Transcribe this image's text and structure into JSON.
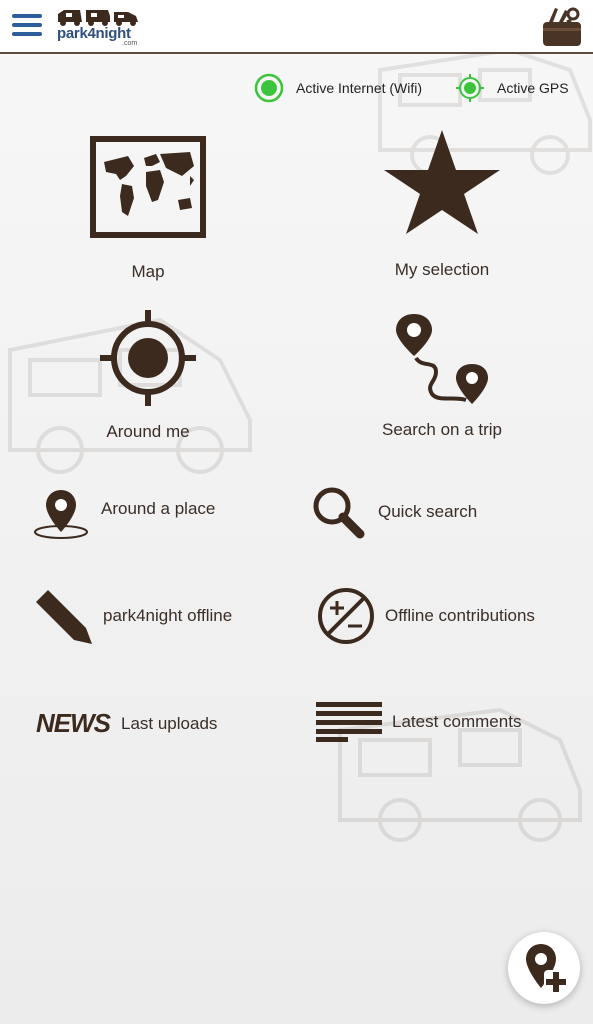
{
  "header": {
    "logo_text": "park4night",
    "logo_domain": ".com",
    "menu_icon": "hamburger-menu-icon",
    "tools_icon": "toolbox-icon"
  },
  "status": {
    "internet": "Active Internet (Wifi)",
    "gps": "Active GPS",
    "color_active": "#3cc43c"
  },
  "menu": {
    "map": "Map",
    "my_selection": "My selection",
    "around_me": "Around me",
    "search_trip": "Search on a trip",
    "around_place": "Around a place",
    "quick_search": "Quick search",
    "offline": "park4night offline",
    "offline_contrib": "Offline contributions",
    "news_icon_text": "NEWS",
    "last_uploads": "Last uploads",
    "latest_comments": "Latest comments"
  },
  "colors": {
    "brown": "#3d2a1f",
    "blue": "#2d5d9a"
  }
}
